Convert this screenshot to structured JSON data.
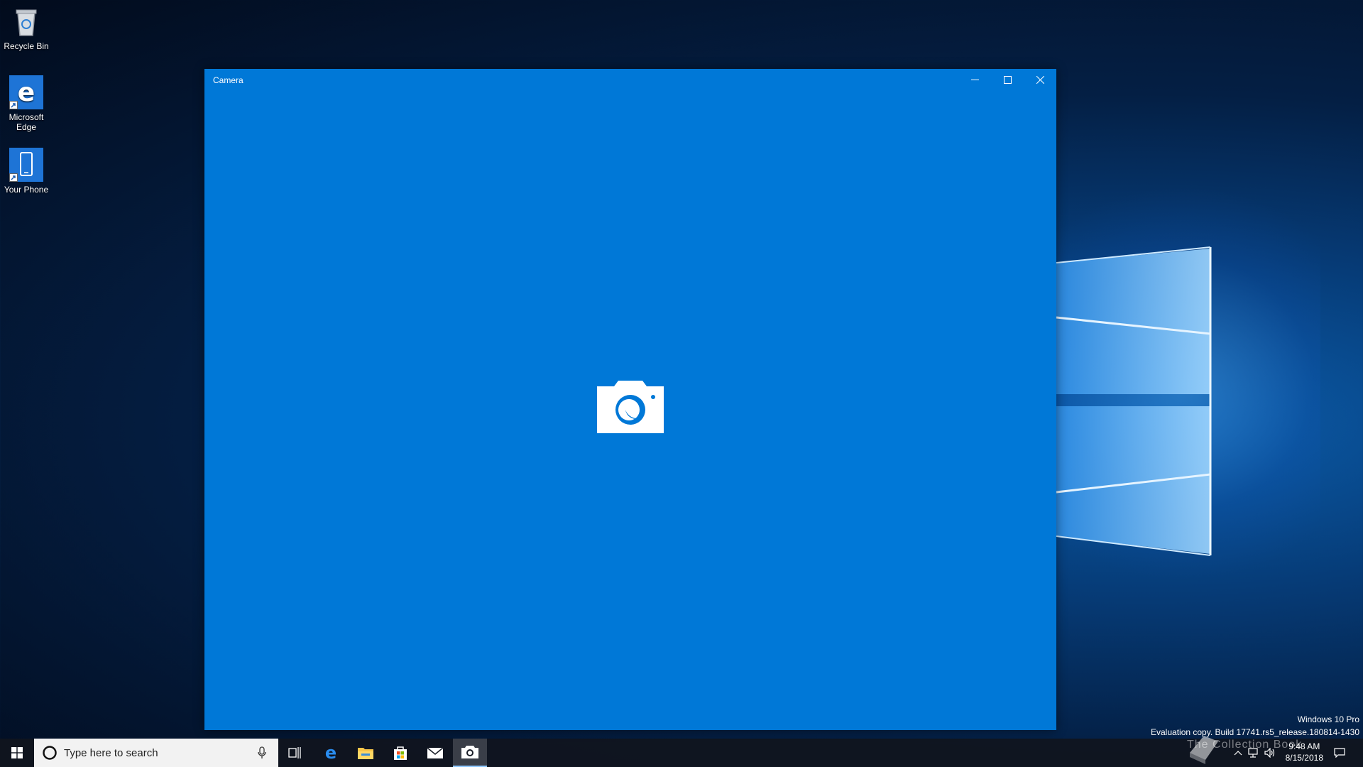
{
  "desktop": {
    "icons": [
      {
        "label": "Recycle Bin",
        "icon": "recycle-bin-icon"
      },
      {
        "label": "Microsoft Edge",
        "icon": "edge-icon"
      },
      {
        "label": "Your Phone",
        "icon": "phone-icon"
      }
    ]
  },
  "window": {
    "title": "Camera",
    "accent": "#0078d7",
    "center_icon": "camera-icon"
  },
  "watermark": {
    "edition": "Windows 10 Pro",
    "build": "Evaluation copy. Build 17741.rs5_release.180814-1430"
  },
  "taskbar": {
    "search_placeholder": "Type here to search",
    "apps": [
      "task-view-icon",
      "edge-icon",
      "file-explorer-icon",
      "store-icon",
      "mail-icon",
      "camera-icon"
    ],
    "active_app": "camera-icon",
    "clock_time": "9:48 AM",
    "clock_date": "8/15/2018"
  },
  "overlay_watermark": "The Collection Book"
}
